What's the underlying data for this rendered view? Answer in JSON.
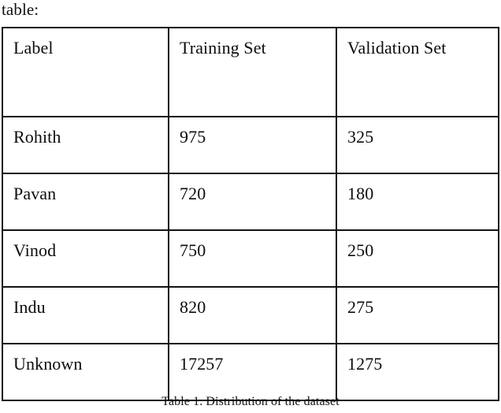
{
  "document": {
    "lead_in_text": "table:",
    "caption": "Table 1. Distribution of the dataset"
  },
  "table": {
    "columns": [
      "Label",
      "Training Set",
      "Validation Set"
    ],
    "rows": [
      {
        "label": "Rohith",
        "training": "975",
        "validation": "325"
      },
      {
        "label": "Pavan",
        "training": "720",
        "validation": "180"
      },
      {
        "label": "Vinod",
        "training": "750",
        "validation": "250"
      },
      {
        "label": "Indu",
        "training": "820",
        "validation": "275"
      },
      {
        "label": "Unknown",
        "training": "17257",
        "validation": "1275"
      }
    ]
  },
  "style": {
    "border_color": "#131313",
    "text_color": "#0d0d0d",
    "background": "#ffffff"
  }
}
